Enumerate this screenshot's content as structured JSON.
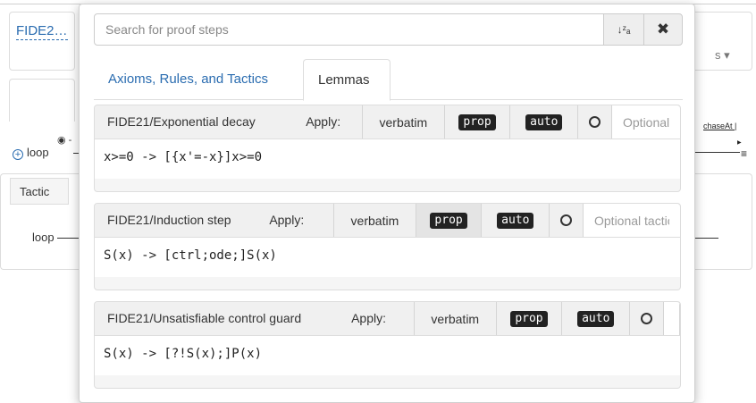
{
  "background": {
    "title": "FIDE2…",
    "dropdown_fragment": "s ▾",
    "loop_label": "loop",
    "chase_label": "chaseAt |",
    "tab_tactic": "Tactic",
    "loop_node": "loop"
  },
  "search": {
    "placeholder": "Search for proof steps",
    "sort_icon": "↓ᶻₐ",
    "close_icon": "✖"
  },
  "tabs": [
    {
      "label": "Axioms, Rules, and Tactics",
      "active": false
    },
    {
      "label": "Lemmas",
      "active": true
    }
  ],
  "lemmas": [
    {
      "name": "FIDE21/Exponential decay",
      "apply": "Apply:",
      "options": {
        "verbatim": "verbatim",
        "prop": "prop",
        "auto": "auto"
      },
      "input_placeholder": "Optional tactic",
      "formula": "x>=0 -> [{x'=-x}]x>=0"
    },
    {
      "name": "FIDE21/Induction step",
      "apply": "Apply:",
      "options": {
        "verbatim": "verbatim",
        "prop": "prop",
        "auto": "auto"
      },
      "input_placeholder": "Optional tactic",
      "formula": "S(x) -> [ctrl;ode;]S(x)"
    },
    {
      "name": "FIDE21/Unsatisfiable control guard",
      "apply": "Apply:",
      "options": {
        "verbatim": "verbatim",
        "prop": "prop",
        "auto": "auto"
      },
      "input_placeholder": "",
      "formula": "S(x) -> [?!S(x);]P(x)"
    }
  ],
  "colors": {
    "link": "#2a6cb0",
    "badge_bg": "#222222",
    "card_header_bg": "#f0f0f0"
  }
}
